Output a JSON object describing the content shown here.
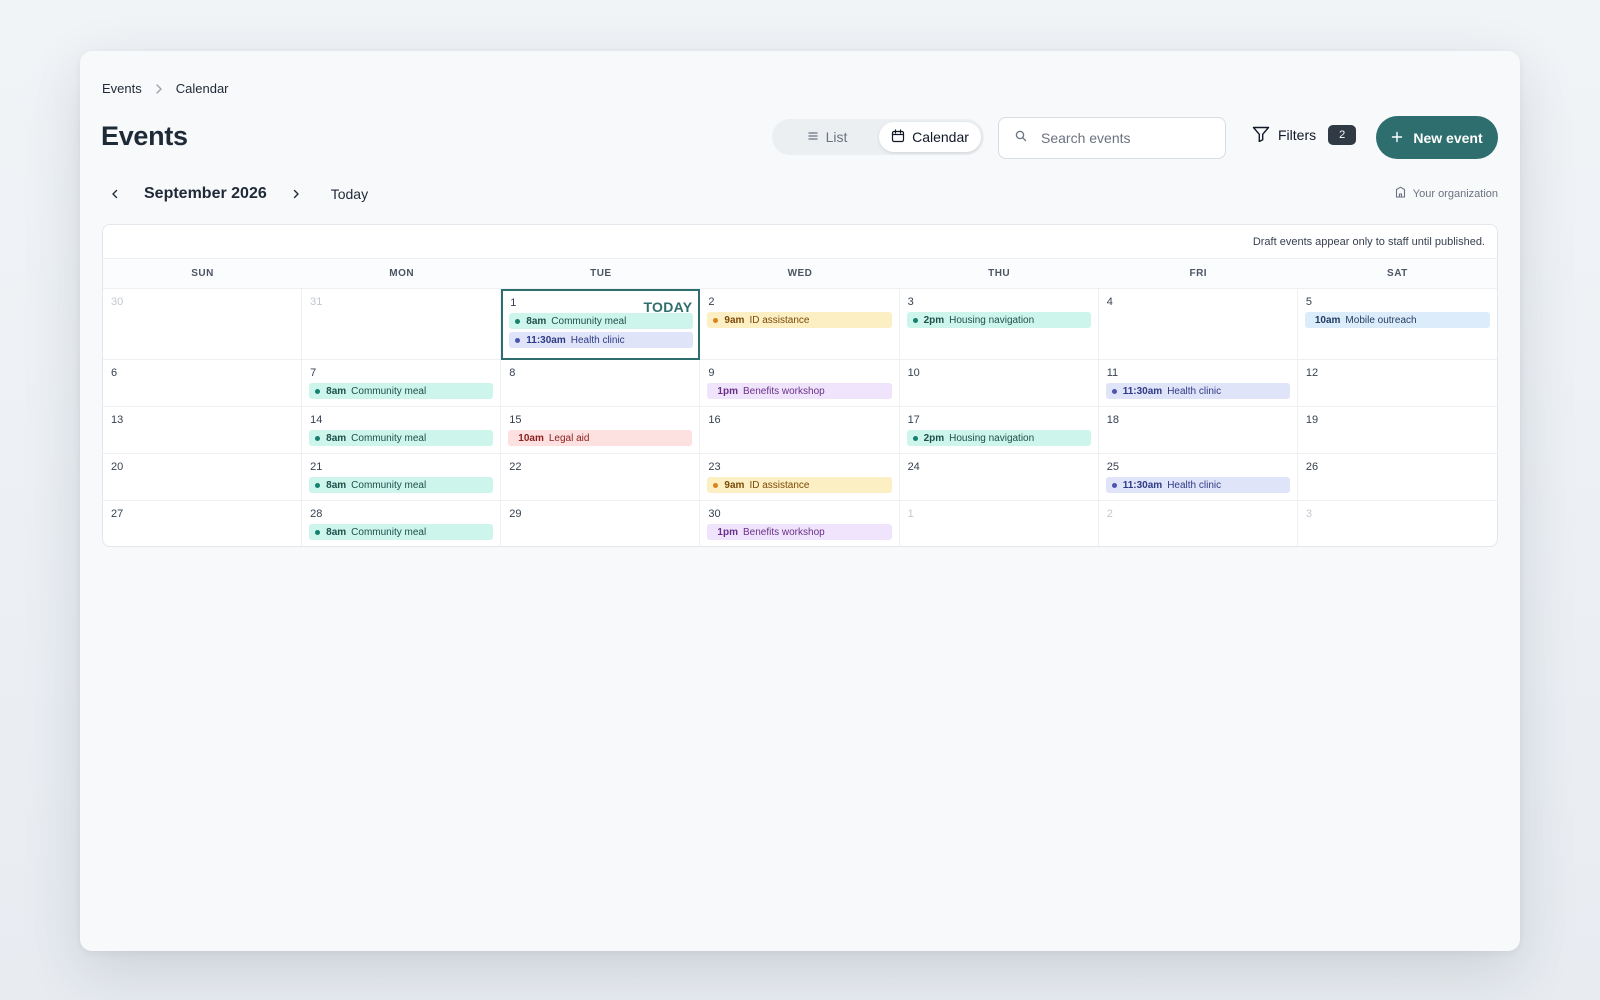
{
  "breadcrumb": {
    "root": "Events",
    "current": "Calendar"
  },
  "page_title": "Events",
  "view_toggle": {
    "list_label": "List",
    "calendar_label": "Calendar",
    "active": "Calendar"
  },
  "search": {
    "placeholder": "Search events",
    "value": ""
  },
  "filters": {
    "label": "Filters",
    "count": "2"
  },
  "new_event_label": "New event",
  "nav": {
    "month": "September 2026",
    "today_label": "Today"
  },
  "organization": "Your organization",
  "calendar": {
    "note": "Draft events appear only to staff until published.",
    "weekdays": [
      "SUN",
      "MON",
      "TUE",
      "WED",
      "THU",
      "FRI",
      "SAT"
    ],
    "today_label": "TODAY",
    "days": [
      {
        "day": "30",
        "muted": true,
        "events": []
      },
      {
        "day": "31",
        "muted": true,
        "events": []
      },
      {
        "day": "1",
        "today": true,
        "events": [
          {
            "time": "8am",
            "title": "Community meal",
            "color": "teal",
            "dot": true
          },
          {
            "time": "11:30am",
            "title": "Health clinic",
            "color": "indigo",
            "dot": true
          }
        ]
      },
      {
        "day": "2",
        "events": [
          {
            "time": "9am",
            "title": "ID assistance",
            "color": "amber",
            "dot": true
          }
        ]
      },
      {
        "day": "3",
        "events": [
          {
            "time": "2pm",
            "title": "Housing navigation",
            "color": "teal",
            "dot": true
          }
        ]
      },
      {
        "day": "4",
        "events": []
      },
      {
        "day": "5",
        "events": [
          {
            "time": "10am",
            "title": "Mobile outreach",
            "color": "blue",
            "dot": false
          }
        ]
      },
      {
        "day": "6",
        "events": []
      },
      {
        "day": "7",
        "events": [
          {
            "time": "8am",
            "title": "Community meal",
            "color": "teal",
            "dot": true
          }
        ]
      },
      {
        "day": "8",
        "events": []
      },
      {
        "day": "9",
        "events": [
          {
            "time": "1pm",
            "title": "Benefits workshop",
            "color": "purple",
            "dot": false
          }
        ]
      },
      {
        "day": "10",
        "events": []
      },
      {
        "day": "11",
        "events": [
          {
            "time": "11:30am",
            "title": "Health clinic",
            "color": "indigo",
            "dot": true
          }
        ]
      },
      {
        "day": "12",
        "events": []
      },
      {
        "day": "13",
        "events": []
      },
      {
        "day": "14",
        "events": [
          {
            "time": "8am",
            "title": "Community meal",
            "color": "teal",
            "dot": true
          }
        ]
      },
      {
        "day": "15",
        "events": [
          {
            "time": "10am",
            "title": "Legal aid",
            "color": "red",
            "dot": false
          }
        ]
      },
      {
        "day": "16",
        "events": []
      },
      {
        "day": "17",
        "events": [
          {
            "time": "2pm",
            "title": "Housing navigation",
            "color": "teal",
            "dot": true
          }
        ]
      },
      {
        "day": "18",
        "events": []
      },
      {
        "day": "19",
        "events": []
      },
      {
        "day": "20",
        "events": []
      },
      {
        "day": "21",
        "events": [
          {
            "time": "8am",
            "title": "Community meal",
            "color": "teal",
            "dot": true
          }
        ]
      },
      {
        "day": "22",
        "events": []
      },
      {
        "day": "23",
        "events": [
          {
            "time": "9am",
            "title": "ID assistance",
            "color": "amber",
            "dot": true
          }
        ]
      },
      {
        "day": "24",
        "events": []
      },
      {
        "day": "25",
        "events": [
          {
            "time": "11:30am",
            "title": "Health clinic",
            "color": "indigo",
            "dot": true
          }
        ]
      },
      {
        "day": "26",
        "events": []
      },
      {
        "day": "27",
        "events": []
      },
      {
        "day": "28",
        "events": [
          {
            "time": "8am",
            "title": "Community meal",
            "color": "teal",
            "dot": true
          }
        ]
      },
      {
        "day": "29",
        "events": []
      },
      {
        "day": "30",
        "events": [
          {
            "time": "1pm",
            "title": "Benefits workshop",
            "color": "purple",
            "dot": false
          }
        ]
      },
      {
        "day": "1",
        "muted": true,
        "events": []
      },
      {
        "day": "2",
        "muted": true,
        "events": []
      },
      {
        "day": "3",
        "muted": true,
        "events": []
      }
    ]
  },
  "colors": {
    "accent": "#2f6e6e",
    "badge": "#2f3a44"
  }
}
